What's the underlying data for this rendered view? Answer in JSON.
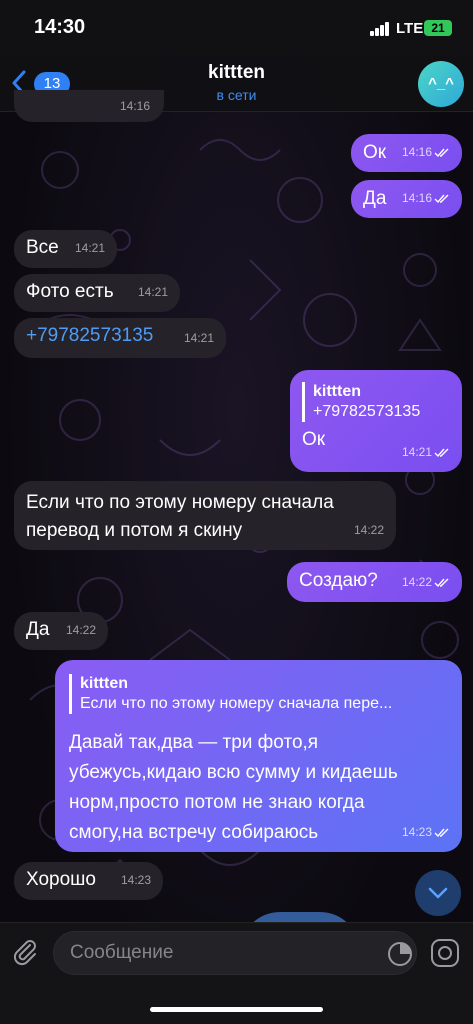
{
  "status_bar": {
    "time": "14:30",
    "network": "LTE",
    "battery": "21"
  },
  "header": {
    "back_count": "13",
    "title": "kittten",
    "status": "в сети",
    "avatar_text": "^_^"
  },
  "messages": [
    {
      "dir": "in",
      "text": "...",
      "time": "14:16"
    },
    {
      "dir": "out",
      "text": "Ок",
      "time": "14:16"
    },
    {
      "dir": "out",
      "text": "Да",
      "time": "14:16"
    },
    {
      "dir": "in",
      "text": "Все",
      "time": "14:21"
    },
    {
      "dir": "in",
      "text": "Фото есть",
      "time": "14:21"
    },
    {
      "dir": "in",
      "text": "+79782573135",
      "time": "14:21"
    },
    {
      "dir": "out",
      "reply_name": "kittten",
      "reply_text": "+79782573135",
      "text": "Ок",
      "time": "14:21"
    },
    {
      "dir": "in",
      "text": "Если что по этому номеру сначала перевод и потом я скину",
      "time": "14:22"
    },
    {
      "dir": "out",
      "text": "Создаю?",
      "time": "14:22"
    },
    {
      "dir": "in",
      "text": "Да",
      "time": "14:22"
    },
    {
      "dir": "out",
      "reply_name": "kittten",
      "reply_text": "Если что по этому номеру сначала пере...",
      "text": "Давай так,два — три фото,я убежусь,кидаю всю сумму и кидаешь норм,просто потом не знаю когда смогу,на встречу собираюсь",
      "time": "14:23"
    },
    {
      "dir": "in",
      "text": "Хорошо",
      "time": "14:23"
    }
  ],
  "input": {
    "placeholder": "Сообщение"
  },
  "icons": {
    "back": "chevron-left-icon",
    "attach": "paperclip-icon",
    "sticker": "sticker-icon",
    "camera": "camera-icon",
    "scroll": "chevron-down-icon"
  },
  "colors": {
    "accent": "#2f7ff5",
    "outgoing": "#8e58f0",
    "incoming": "#252329"
  }
}
